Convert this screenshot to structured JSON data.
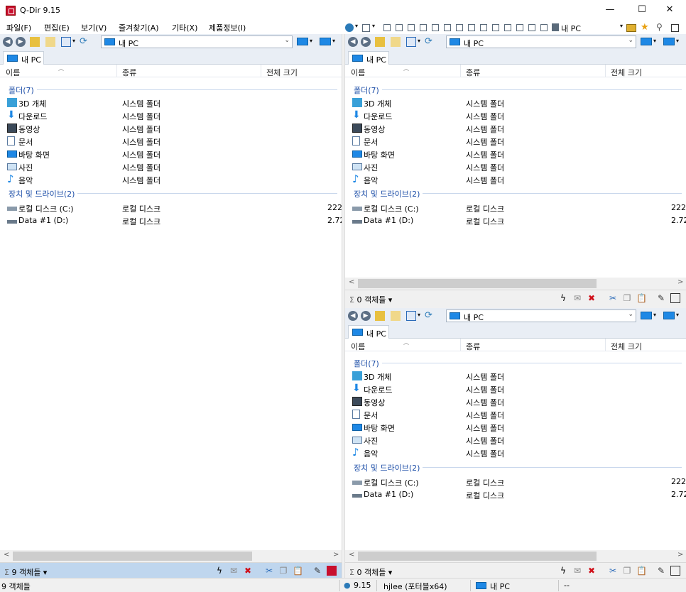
{
  "window": {
    "title": "Q-Dir 9.15",
    "minimize": "—",
    "maximize": "☐",
    "close": "✕"
  },
  "menu": [
    "파일(F)",
    "편집(E)",
    "보기(V)",
    "즐겨찾기(A)",
    "기타(X)",
    "제품정보(I)"
  ],
  "topbar": {
    "location_label": "내 PC"
  },
  "columns": {
    "name": "이름",
    "type": "종류",
    "size": "전체 크기"
  },
  "pane": {
    "address": "내 PC",
    "tab": "내 PC",
    "groups": {
      "folders": "폴더(7)",
      "drives": "장치 및 드라이브(2)"
    },
    "folders": [
      {
        "name": "3D 개체",
        "type": "시스템 폴더",
        "icon": "cube-icon"
      },
      {
        "name": "다운로드",
        "type": "시스템 폴더",
        "icon": "download-icon"
      },
      {
        "name": "동영상",
        "type": "시스템 폴더",
        "icon": "video-icon"
      },
      {
        "name": "문서",
        "type": "시스템 폴더",
        "icon": "document-icon"
      },
      {
        "name": "바탕 화면",
        "type": "시스템 폴더",
        "icon": "desktop-icon"
      },
      {
        "name": "사진",
        "type": "시스템 폴더",
        "icon": "picture-icon"
      },
      {
        "name": "음악",
        "type": "시스템 폴더",
        "icon": "music-icon"
      }
    ],
    "drives": [
      {
        "name": "로컬 디스크 (C:)",
        "type": "로컬 디스크",
        "size": "222",
        "icon": "windows-drive-icon"
      },
      {
        "name": "Data #1 (D:)",
        "type": "로컬 디스크",
        "size": "2.72",
        "icon": "drive-icon"
      }
    ]
  },
  "status": {
    "left": "9 객체들",
    "right_top": "0 객체들",
    "right_bottom": "0 객체들"
  },
  "mainstatus": {
    "count": "9 객체들",
    "version": "9.15",
    "user": "hjlee (포터블x64)",
    "location": "내 PC",
    "dash": "--"
  },
  "colors": {
    "accent": "#1e88e5",
    "status_active": "#bfd6ee",
    "group": "#1e4fa8"
  }
}
